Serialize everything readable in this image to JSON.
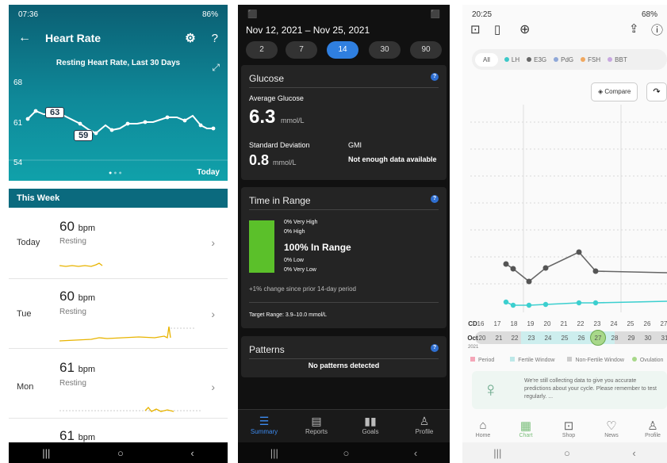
{
  "p1": {
    "time": "07:36",
    "status_right": "86%",
    "title": "Heart Rate",
    "chart_title": "Resting Heart Rate, Last 30 Days",
    "y_high": "68",
    "y_mid": "61",
    "y_low": "54",
    "bubble_max": "63",
    "bubble_min": "59",
    "today_label": "Today",
    "week_label": "This Week",
    "rows": [
      {
        "day": "Today",
        "bpm": "60",
        "unit": "bpm",
        "sub": "Resting"
      },
      {
        "day": "Tue",
        "bpm": "60",
        "unit": "bpm",
        "sub": "Resting"
      },
      {
        "day": "Mon",
        "bpm": "61",
        "unit": "bpm",
        "sub": "Resting"
      },
      {
        "day": "",
        "bpm": "61",
        "unit": "bpm",
        "sub": ""
      }
    ]
  },
  "p2": {
    "date_range": "Nov 12, 2021 – Nov 25, 2021",
    "periods": [
      "2",
      "7",
      "14",
      "30",
      "90"
    ],
    "glucose": {
      "title": "Glucose",
      "avg_label": "Average Glucose",
      "avg_value": "6.3",
      "avg_unit": "mmol/L",
      "sd_label": "Standard Deviation",
      "sd_value": "0.8",
      "sd_unit": "mmol/L",
      "gmi_label": "GMI",
      "gmi_value": "Not enough data available"
    },
    "tir": {
      "title": "Time in Range",
      "very_high": "0% Very High",
      "high": "0% High",
      "in_range": "100% In Range",
      "low": "0% Low",
      "very_low": "0% Very Low",
      "change": "+1% change since prior 14-day period",
      "target": "Target Range: 3.9–10.0 mmol/L"
    },
    "patterns": {
      "title": "Patterns",
      "text": "No patterns detected"
    },
    "tabs": [
      "Summary",
      "Reports",
      "Goals",
      "Profile"
    ]
  },
  "p3": {
    "time": "20:25",
    "status_right": "68%",
    "filters": [
      "All",
      "LH",
      "E3G",
      "PdG",
      "FSH",
      "BBT"
    ],
    "compare": "Compare",
    "cd_label": "CD",
    "cd": [
      "16",
      "17",
      "18",
      "19",
      "20",
      "21",
      "22",
      "23",
      "24",
      "25",
      "26",
      "27"
    ],
    "month": "Oct",
    "year": "2021",
    "dates": [
      "20",
      "21",
      "22",
      "23",
      "24",
      "25",
      "26",
      "27",
      "28",
      "29",
      "30",
      "31"
    ],
    "legend": [
      "Period",
      "Fertile Window",
      "Non-Fertile Window",
      "Ovulation"
    ],
    "info": "We're still collecting data to give you accurate predictions about your cycle. Please remember to test regularly. ...",
    "tabs": [
      "Home",
      "Chart",
      "Shop",
      "News",
      "Profile"
    ]
  }
}
